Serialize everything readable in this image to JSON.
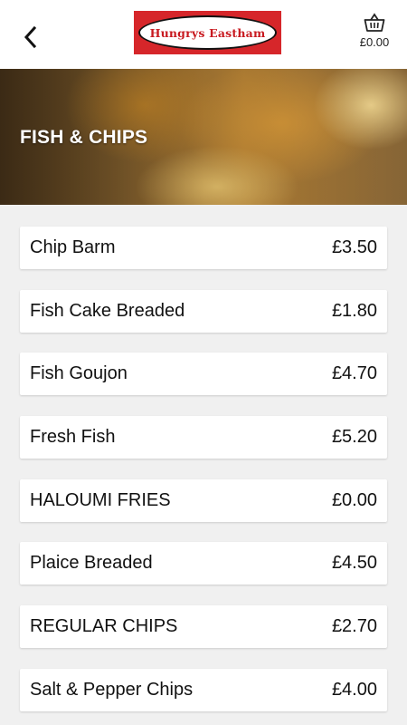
{
  "header": {
    "logo_text": "Hungrys Eastham",
    "cart_total": "£0.00",
    "back_icon": "chevron-left-icon",
    "cart_icon": "basket-icon"
  },
  "category": {
    "title": "FISH & CHIPS"
  },
  "items": [
    {
      "name": "Chip Barm",
      "price": "£3.50"
    },
    {
      "name": "Fish Cake Breaded",
      "price": "£1.80"
    },
    {
      "name": "Fish Goujon",
      "price": "£4.70"
    },
    {
      "name": "Fresh Fish",
      "price": "£5.20"
    },
    {
      "name": "HALOUMI FRIES",
      "price": "£0.00"
    },
    {
      "name": "Plaice Breaded",
      "price": "£4.50"
    },
    {
      "name": "REGULAR CHIPS",
      "price": "£2.70"
    },
    {
      "name": "Salt & Pepper Chips",
      "price": "£4.00"
    }
  ],
  "colors": {
    "brand_red": "#d6262a",
    "background": "#f0f0f0"
  }
}
